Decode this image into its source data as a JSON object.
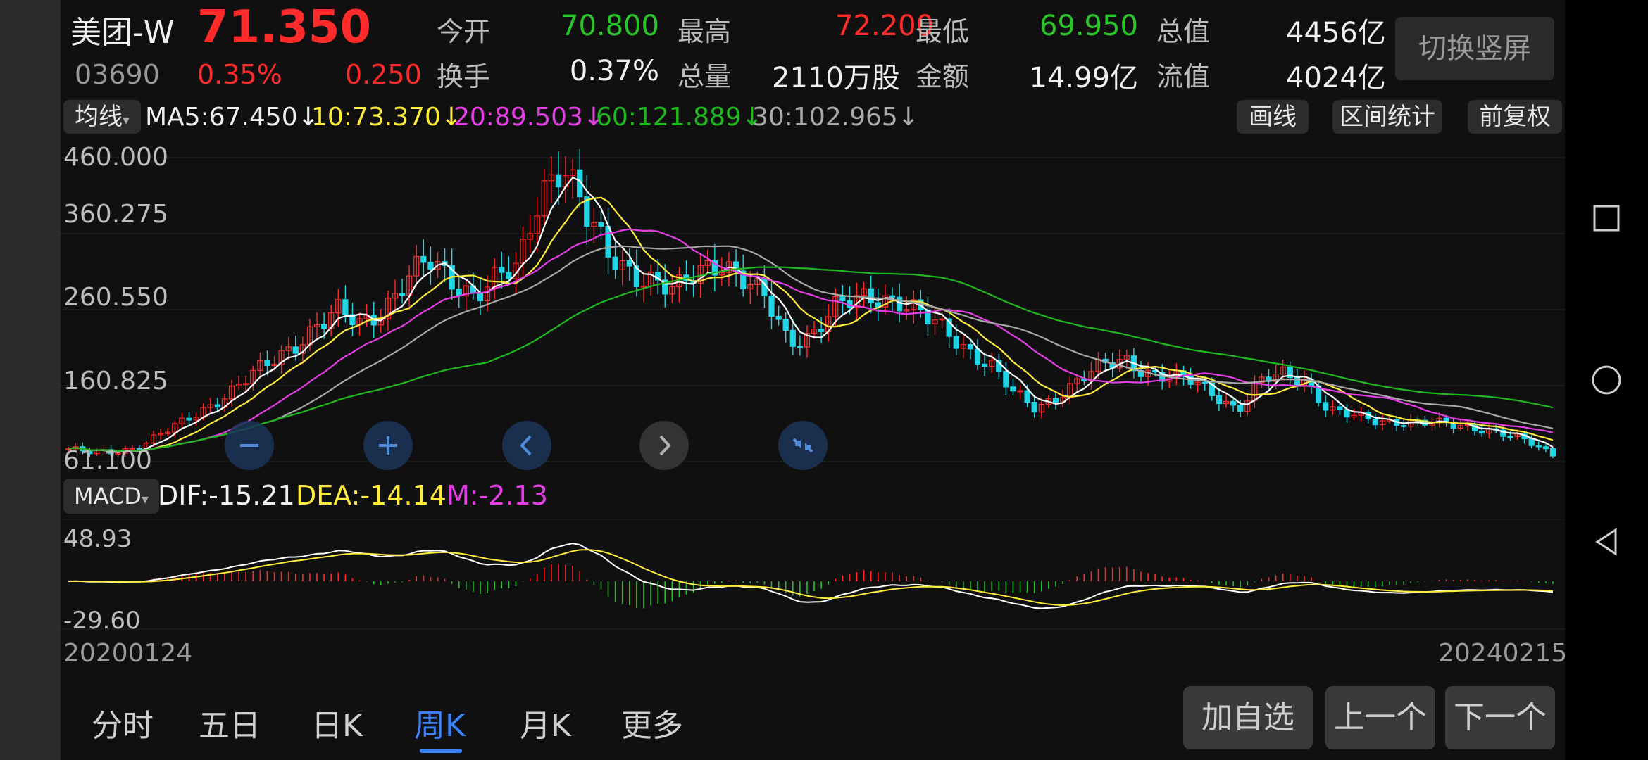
{
  "stock": {
    "name": "美团-W",
    "code": "03690",
    "price": "71.350",
    "change_pct": "0.35%",
    "change": "0.250",
    "switch_btn": "切换竖屏"
  },
  "quote": {
    "open_label": "今开",
    "open": "70.800",
    "high_label": "最高",
    "high": "72.200",
    "low_label": "最低",
    "low": "69.950",
    "mcap_label": "总值",
    "mcap": "4456亿",
    "turnover_label": "换手",
    "turnover": "0.37%",
    "volume_label": "总量",
    "volume": "2110万股",
    "amount_label": "金额",
    "amount": "14.99亿",
    "float_label": "流值",
    "float": "4024亿"
  },
  "ma_bar": {
    "dropdown": "均线",
    "ma5": "MA5:67.450↓",
    "ma10": "10:73.370↓",
    "ma20": "20:89.503↓",
    "ma60": "60:121.889↓",
    "ma30": "30:102.965↓",
    "draw_btn": "画线",
    "range_btn": "区间统计",
    "adjust_btn": "前复权"
  },
  "price_axis": [
    "460.000",
    "360.275",
    "260.550",
    "160.825",
    "61.100"
  ],
  "macd_bar": {
    "dropdown": "MACD",
    "dif": "DIF:-15.21",
    "dea": "DEA:-14.14",
    "m": "M:-2.13"
  },
  "macd_axis": [
    "48.93",
    "-29.60"
  ],
  "date_start": "20200124",
  "date_end": "20240215",
  "tabs": [
    "分时",
    "五日",
    "日K",
    "周K",
    "月K",
    "更多"
  ],
  "active_tab": "周K",
  "actions": {
    "add": "加自选",
    "prev": "上一个",
    "next": "下一个"
  },
  "colors": {
    "up": "#ff2b2b",
    "down": "#21d4e6",
    "ma5": "#ffffff",
    "ma10": "#ffeb3b",
    "ma20": "#e63ee6",
    "ma30": "#a8a8a8",
    "ma60": "#1fb81f",
    "accent": "#3b82f6"
  },
  "chart_data": {
    "type": "candlestick",
    "x_range": [
      "20200124",
      "20240215"
    ],
    "ylim": [
      61.1,
      460.0
    ],
    "close_series": [
      78,
      72,
      74,
      80,
      95,
      110,
      130,
      150,
      170,
      190,
      215,
      240,
      255,
      240,
      265,
      300,
      320,
      300,
      285,
      300,
      310,
      420,
      460,
      380,
      330,
      315,
      300,
      280,
      310,
      330,
      300,
      270,
      220,
      230,
      260,
      270,
      280,
      275,
      250,
      230,
      210,
      190,
      150,
      130,
      150,
      170,
      185,
      195,
      180,
      170,
      165,
      150,
      130,
      165,
      175,
      170,
      130,
      120,
      115,
      115,
      112,
      110,
      108,
      105,
      95,
      85,
      71
    ],
    "macd_ylim": [
      -29.6,
      48.93
    ]
  }
}
